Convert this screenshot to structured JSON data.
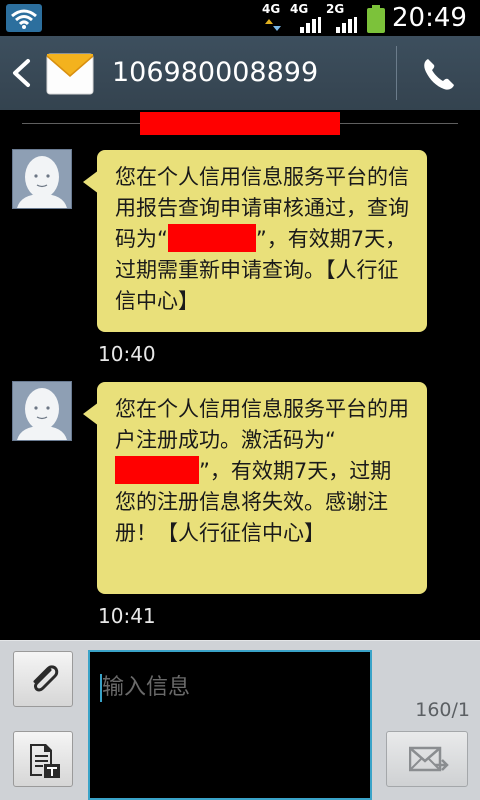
{
  "status_bar": {
    "networks": [
      "4G",
      "4G",
      "2G"
    ],
    "time": "20:49"
  },
  "title_bar": {
    "contact": "106980008899"
  },
  "messages": [
    {
      "segments": [
        {
          "text": "您在个人信用信息服务平台的信用报告查询申请审核通过，查询码为“"
        },
        {
          "text": "”，有效期7天，过期需重新申请查询。【人行征信中心】"
        }
      ],
      "time": "10:40"
    },
    {
      "segments": [
        {
          "text": "您在个人信用信息服务平台的用户注册成功。激活码为“"
        },
        {
          "text": "”，有效期7天，过期您的注册信息将失效。感谢注册！【人行征信中心】"
        }
      ],
      "time": "10:41"
    }
  ],
  "composer": {
    "placeholder": "输入信息",
    "counter": "160/1"
  },
  "colors": {
    "bubble": "#e9e07a",
    "title_bar": "#3a4a58",
    "redaction": "#ff0000",
    "input_focus": "#3aa3c8"
  },
  "icons": {
    "wifi": "wifi-icon",
    "battery": "battery-icon",
    "back": "chevron-left-icon",
    "envelope": "envelope-icon",
    "call": "phone-icon",
    "avatar": "contact-avatar-icon",
    "attach": "paperclip-icon",
    "text_template": "text-template-icon",
    "send": "send-message-icon"
  }
}
